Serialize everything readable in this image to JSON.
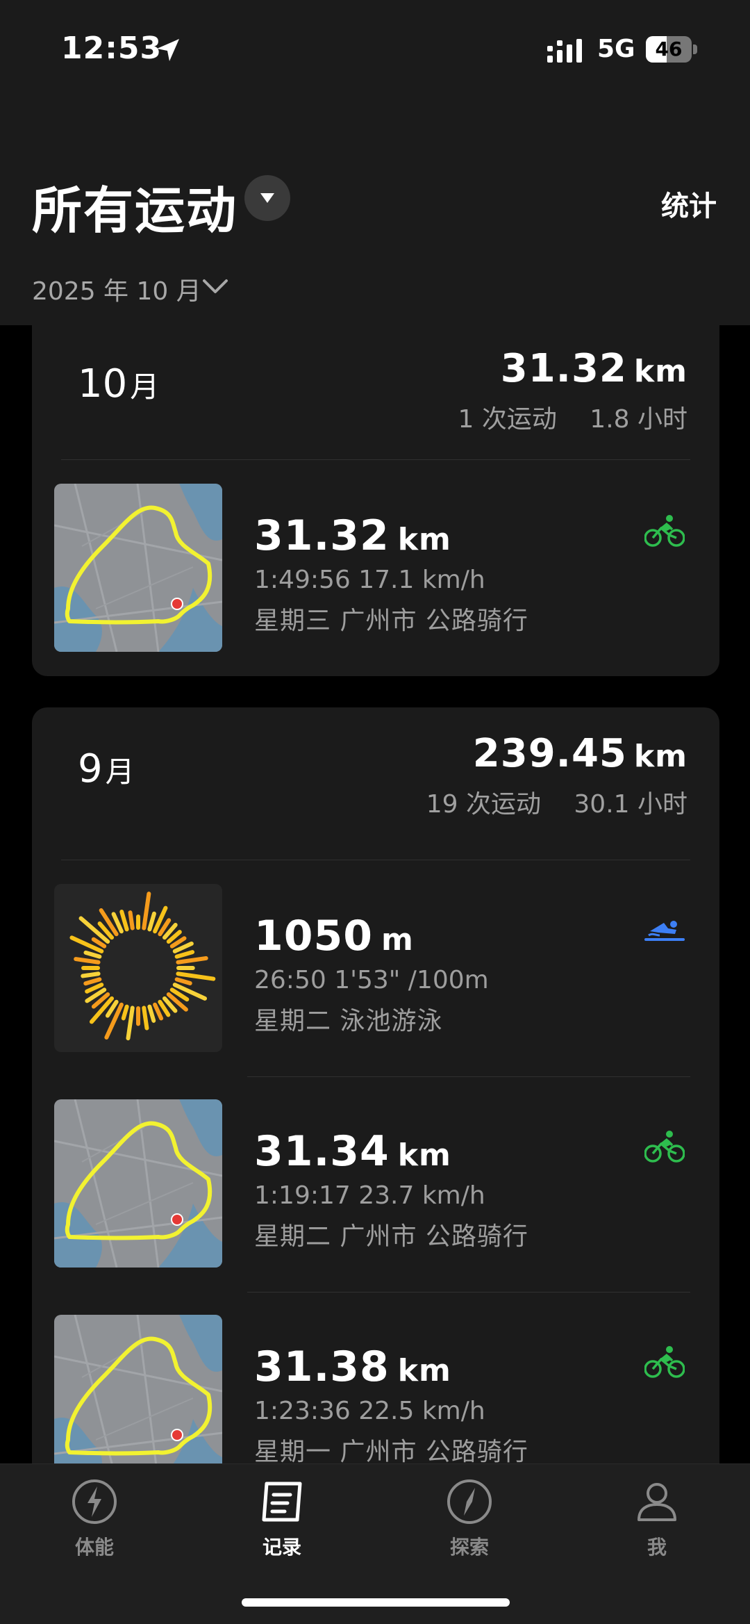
{
  "status_bar": {
    "time": "12:53",
    "network": "5G",
    "battery": "46",
    "battery_level": 0.46
  },
  "header": {
    "title": "所有运动",
    "stats_label": "统计",
    "date_filter": "2025 年 10 月"
  },
  "months": [
    {
      "month": "10",
      "month_unit": "月",
      "distance": "31.32",
      "distance_unit": "km",
      "summary": "1 次运动　 1.8 小时",
      "activities": [
        {
          "distance": "31.32",
          "unit": "km",
          "stats": "1:49:56  17.1 km/h",
          "meta": "星期三 广州市 公路骑行",
          "sport_icon": "cycling-icon",
          "thumb": "route-map"
        }
      ]
    },
    {
      "month": "9",
      "month_unit": "月",
      "distance": "239.45",
      "distance_unit": "km",
      "summary": "19 次运动　 30.1 小时",
      "activities": [
        {
          "distance": "1050",
          "unit": "m",
          "stats": "26:50  1'53\" /100m",
          "meta": "星期二 泳池游泳",
          "sport_icon": "swimming-icon",
          "thumb": "swim-chart"
        },
        {
          "distance": "31.34",
          "unit": "km",
          "stats": "1:19:17  23.7 km/h",
          "meta": "星期二 广州市 公路骑行",
          "sport_icon": "cycling-icon",
          "thumb": "route-map"
        },
        {
          "distance": "31.38",
          "unit": "km",
          "stats": "1:23:36  22.5 km/h",
          "meta": "星期一 广州市 公路骑行",
          "sport_icon": "cycling-icon",
          "thumb": "route-map"
        }
      ]
    }
  ],
  "tabs": [
    {
      "label": "体能",
      "icon": "lightning-icon",
      "active": false
    },
    {
      "label": "记录",
      "icon": "record-icon",
      "active": true
    },
    {
      "label": "探索",
      "icon": "compass-icon",
      "active": false
    },
    {
      "label": "我",
      "icon": "person-icon",
      "active": false
    }
  ],
  "colors": {
    "cycling": "#2ebd4e",
    "swimming": "#3d7ff5",
    "route": "#f2f231",
    "map_land": "#8c8f94",
    "map_water": "#5b8fb3"
  }
}
